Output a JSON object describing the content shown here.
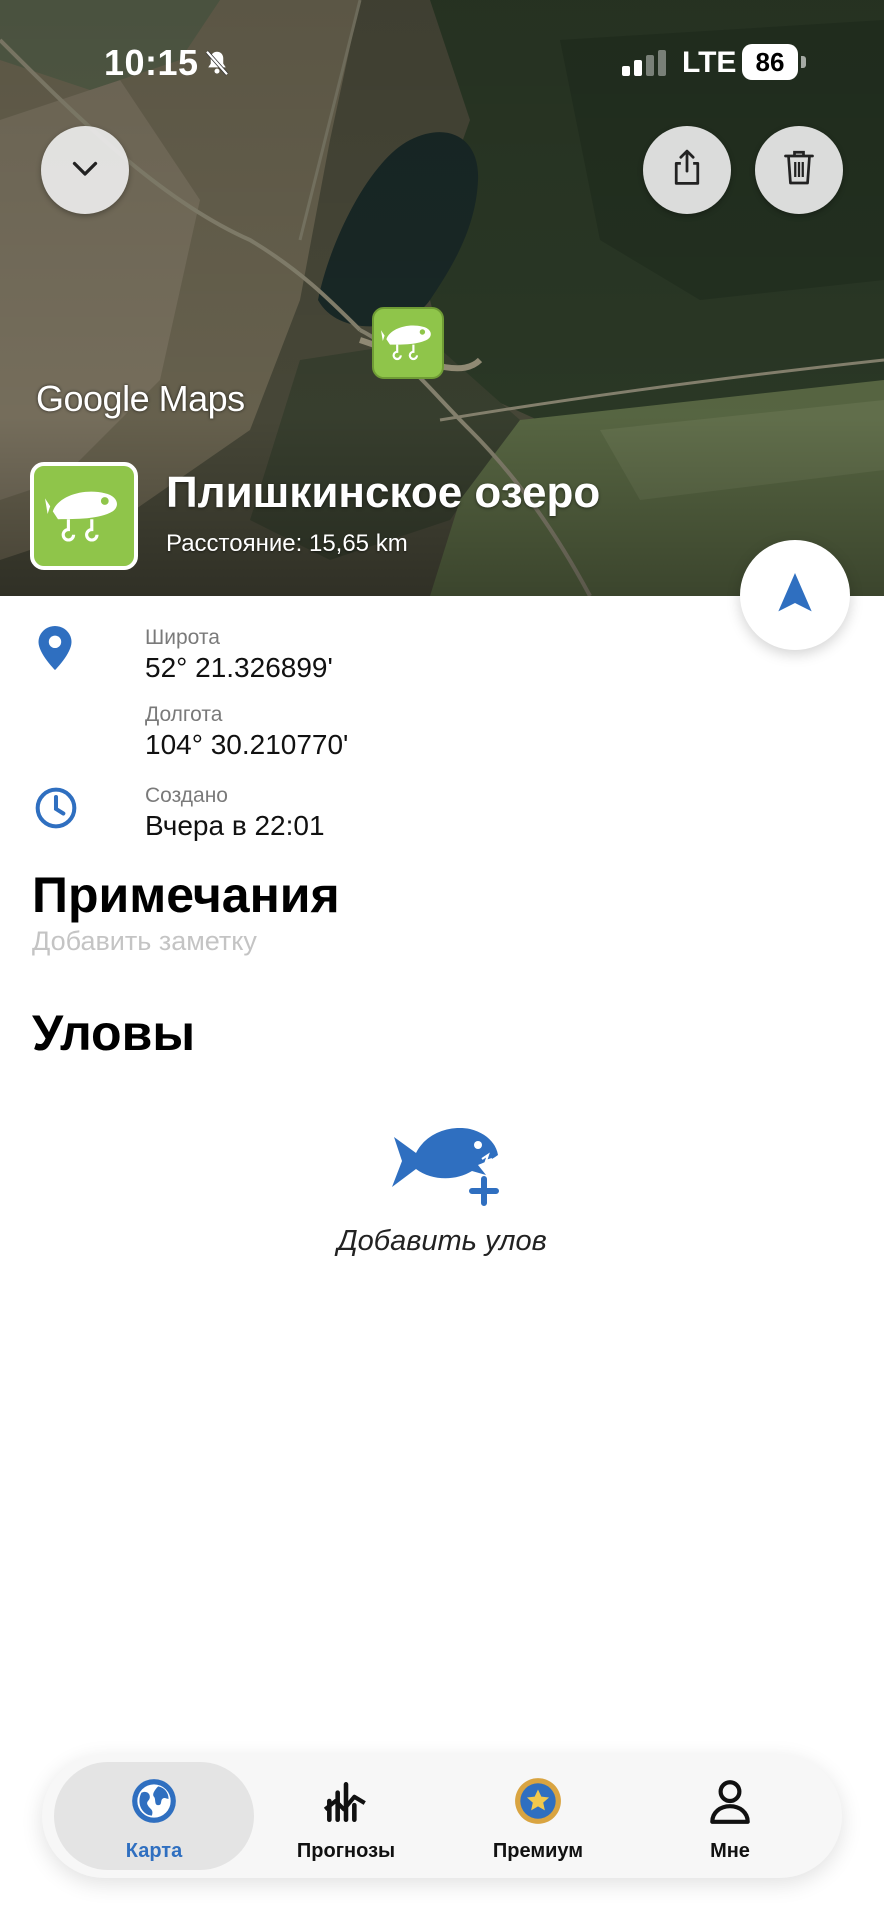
{
  "status_bar": {
    "time": "10:15",
    "network": "LTE",
    "battery": "86"
  },
  "map": {
    "attribution": "Google Maps"
  },
  "place": {
    "title": "Плишкинское озеро",
    "distance": "Расстояние: 15,65 km",
    "icon": "fishing-lure-icon"
  },
  "details": {
    "latitude_label": "Широта",
    "latitude_value": "52° 21.326899'",
    "longitude_label": "Долгота",
    "longitude_value": "104° 30.210770'",
    "created_label": "Создано",
    "created_value": "Вчера в 22:01"
  },
  "notes": {
    "title": "Примечания",
    "placeholder": "Добавить заметку"
  },
  "catches": {
    "title": "Уловы",
    "add_label": "Добавить улов"
  },
  "tabbar": {
    "tabs": [
      {
        "label": "Карта",
        "icon": "globe-icon",
        "active": true
      },
      {
        "label": "Прогнозы",
        "icon": "chart-icon",
        "active": false
      },
      {
        "label": "Премиум",
        "icon": "star-badge-icon",
        "active": false
      },
      {
        "label": "Мне",
        "icon": "person-icon",
        "active": false
      }
    ]
  },
  "colors": {
    "accent": "#2f6fc0",
    "pin_green": "#8fc54a"
  }
}
